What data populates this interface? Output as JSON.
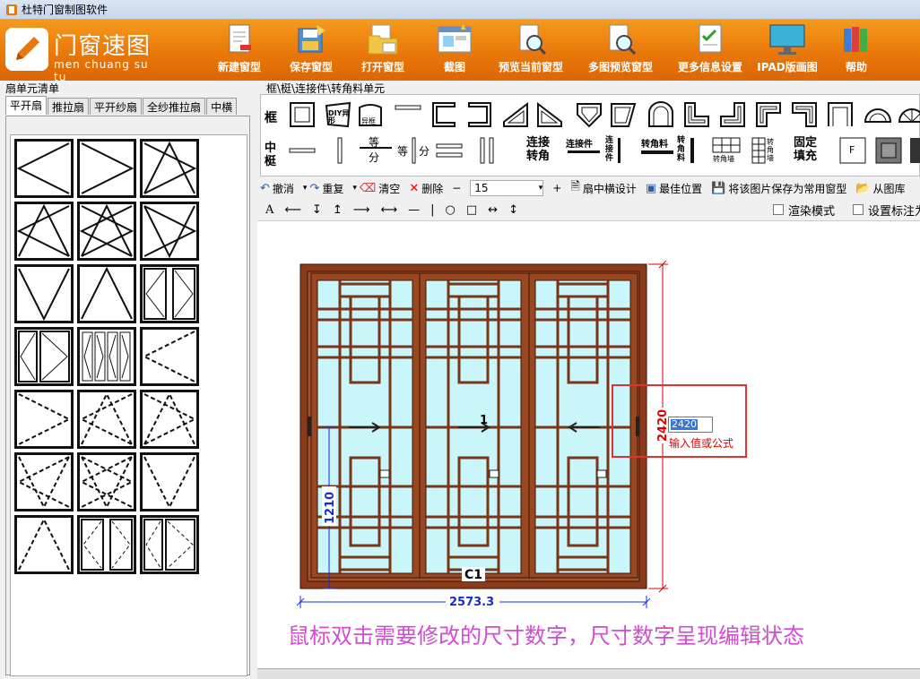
{
  "window": {
    "title": "杜特门窗制图软件"
  },
  "logo": {
    "name": "门窗速图",
    "pinyin": "men chuang su tu"
  },
  "toolbar": {
    "new_window": "新建窗型",
    "save_window": "保存窗型",
    "open_window": "打开窗型",
    "screenshot": "截图",
    "preview_current": "预览当前窗型",
    "preview_multi": "多图预览窗型",
    "more_settings": "更多信息设置",
    "ipad_draw": "IPAD版画图",
    "help": "帮助"
  },
  "left_panel": {
    "title": "扇单元清单",
    "tabs": [
      "平开扇",
      "推拉扇",
      "平开纱扇",
      "全纱推拉扇",
      "中横"
    ],
    "active_tab": "平开扇"
  },
  "right_panel": {
    "title": "框\\梃\\连接件\\转角料单元",
    "row1_label": "框",
    "row2_label": "中梃",
    "diy_label": "DIY异形",
    "yikuang_label": "异框",
    "equal_label": "等",
    "divide_label": "分",
    "connect_turn_label": "连接转角",
    "connector_label": "连接件",
    "connector_v_label": "连接件",
    "turn_material_label": "转角料",
    "turn_material_v_label": "转角料",
    "turn_corner_wall_label": "转角墙",
    "turn_wall_label": "转角墙",
    "fixed_fill_label": "固定填充",
    "f_label": "F"
  },
  "edit_toolbar": {
    "undo": "撤消",
    "redo": "重复",
    "clear": "清空",
    "delete": "删除",
    "minus": "−",
    "value": "15",
    "plus": "+",
    "sash_mid_design": "扇中横设计",
    "best_position": "最佳位置",
    "save_common": "将该图片保存为常用窗型",
    "from_library": "从图库"
  },
  "draw_toolbar": {
    "text_tool": "A",
    "render_mode": "渲染模式",
    "set_readonly_label": "设置标注为只读"
  },
  "drawing": {
    "width_dim": "2573.3",
    "height_dim": "2420",
    "sub_dim": "1210",
    "code": "C1",
    "mark1": "1",
    "input_value": "2420",
    "input_hint": "输入值或公式"
  },
  "hint_text": "鼠标双击需要修改的尺寸数字，尺寸数字呈现编辑状态",
  "colors": {
    "ribbon": "#e9780a",
    "frame": "#8b3a1a",
    "glass": "#c8f6fb",
    "hint": "#d24bd2",
    "dim_blue": "#1a2bd0",
    "dim_red": "#e00000"
  }
}
